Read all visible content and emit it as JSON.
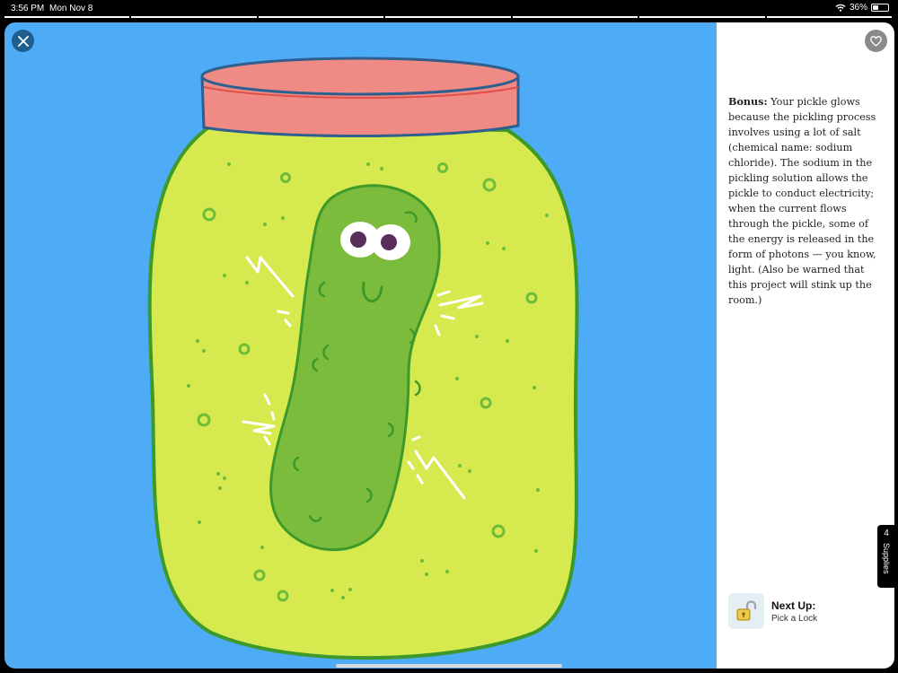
{
  "status": {
    "time": "3:56 PM",
    "date": "Mon Nov 8",
    "battery": "36%",
    "battery_level": 0.36
  },
  "icons": {
    "close": "close-icon",
    "favorite": "heart-icon",
    "wifi": "wifi-icon",
    "battery": "battery-icon",
    "next": "padlock-icon"
  },
  "colors": {
    "stage_bg": "#4eabf5",
    "jar": "#d6ea50",
    "lid": "#f08a84",
    "pickle": "#7cbc3c"
  },
  "content": {
    "bonus_heading": "Bonus:",
    "bonus_text": " Your pickle glows because the pickling process involves using a lot of salt (chemical name: sodium chloride). The sodium in the pickling solution allows the pickle to conduct electricity; when the current flows through the pickle, some of the energy is released in the form of photons — you know, light. (Also be warned that this project will stink up the room.)"
  },
  "supplies": {
    "count": "4",
    "label": "Supplies"
  },
  "next_up": {
    "title": "Next Up:",
    "subtitle": "Pick a Lock"
  }
}
